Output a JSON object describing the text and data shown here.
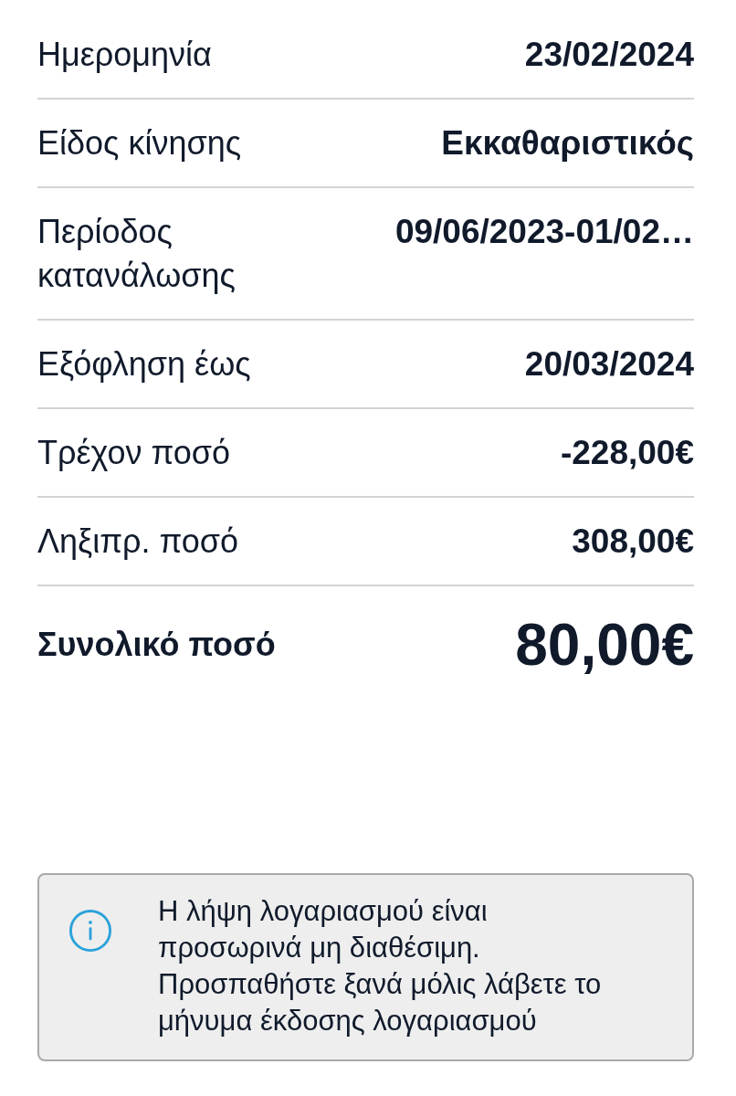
{
  "details": [
    {
      "label": "Ημερομηνία",
      "value": "23/02/2024"
    },
    {
      "label": "Είδος κίνησης",
      "value": "Εκκαθαριστικός"
    },
    {
      "label": "Περίοδος κατανάλωσης",
      "value": "09/06/2023-01/02…"
    },
    {
      "label": "Εξόφληση έως",
      "value": "20/03/2024"
    },
    {
      "label": "Τρέχον ποσό",
      "value": "-228,00€"
    },
    {
      "label": "Ληξιπρ. ποσό",
      "value": "308,00€"
    }
  ],
  "total": {
    "label": "Συνολικό ποσό",
    "value": "80,00€"
  },
  "notice": {
    "kind": "info",
    "text": "Η λήψη λογαριασμού είναι προσωρινά μη διαθέσιμη. Προσπαθήστε ξανά μόλις λάβετε το μήνυμα έκδοσης λογαριασμού"
  }
}
